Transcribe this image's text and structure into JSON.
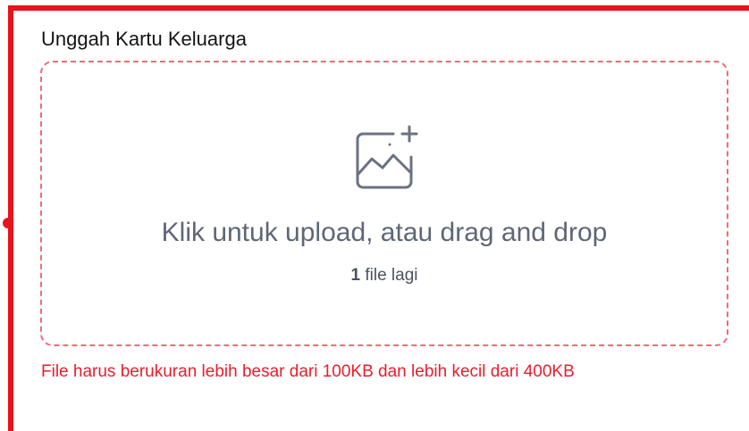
{
  "upload": {
    "label": "Unggah Kartu Keluarga",
    "prompt": "Klik untuk upload, atau drag and drop",
    "remaining_count": "1",
    "remaining_suffix": " file lagi",
    "icon": "image-add-icon"
  },
  "error": {
    "message": "File harus berukuran lebih besar dari 100KB dan lebih kecil dari 400KB"
  },
  "colors": {
    "highlight": "#e8141b",
    "dropzone_border": "#ec6d77",
    "error_text": "#ea1d2c",
    "prompt_text": "#5f6776"
  }
}
